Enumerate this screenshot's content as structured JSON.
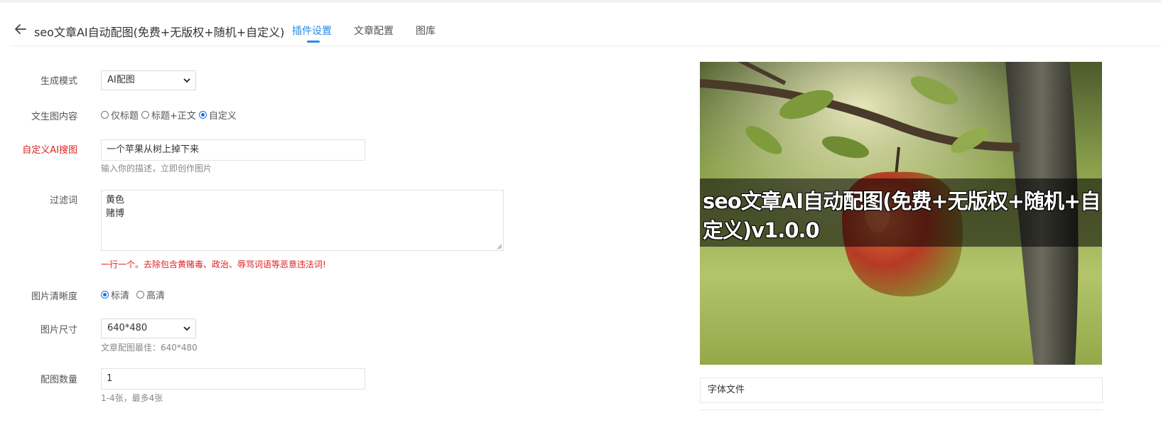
{
  "header": {
    "title": "seo文章AI自动配图(免费+无版权+随机+自定义)",
    "tabs": [
      {
        "label": "插件设置",
        "active": true
      },
      {
        "label": "文章配置",
        "active": false
      },
      {
        "label": "图库",
        "active": false
      }
    ]
  },
  "form": {
    "mode": {
      "label": "生成模式",
      "value": "AI配图"
    },
    "content": {
      "label": "文生图内容",
      "options": [
        "仅标题",
        "标题+正文",
        "自定义"
      ],
      "selected": "自定义"
    },
    "custom": {
      "label": "自定义AI搜图",
      "value": "一个苹果从树上掉下来",
      "help": "输入你的描述，立即创作图片"
    },
    "filter": {
      "label": "过滤词",
      "lines": [
        "黄色",
        "赌博"
      ],
      "warning": "一行一个。去除包含黄赌毒、政治、辱骂词语等恶意违法词!"
    },
    "clarity": {
      "label": "图片清晰度",
      "options": [
        "标清",
        "高清"
      ],
      "selected": "标清"
    },
    "size": {
      "label": "图片尺寸",
      "value": "640*480",
      "help": "文章配图最佳：640*480"
    },
    "count": {
      "label": "配图数量",
      "value": "1",
      "help": "1-4张，最多4张"
    }
  },
  "preview": {
    "overlay_text": "seo文章AI自动配图(免费+无版权+随机+自定义)v1.0.0",
    "font_field_label": "字体文件"
  },
  "colors": {
    "accent": "#2b8be6",
    "danger": "#e02020"
  },
  "icons": {
    "back": "arrow-left-icon",
    "dropdown": "chevron-down-icon"
  }
}
